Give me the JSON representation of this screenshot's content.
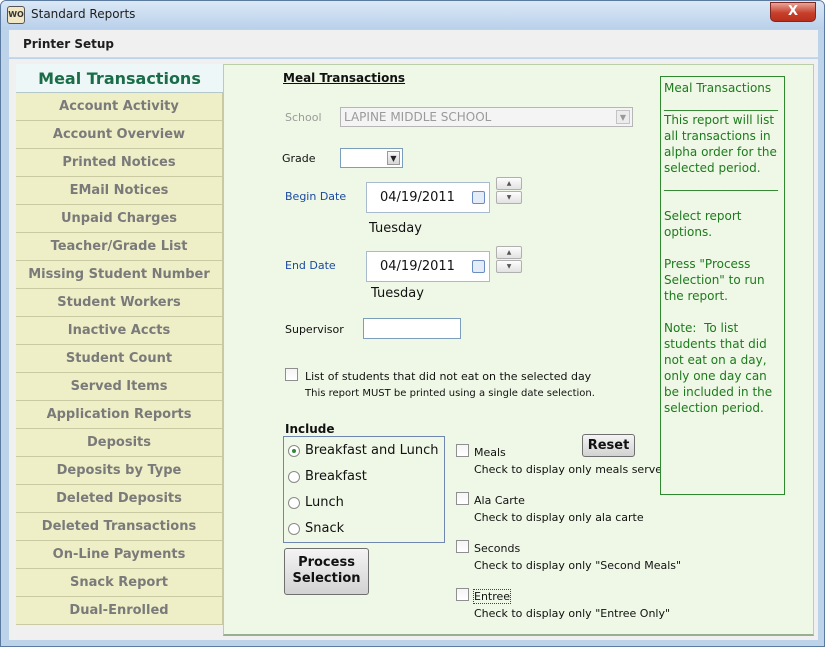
{
  "window": {
    "title": "Standard Reports",
    "icon_text": "WO",
    "close_label": "X"
  },
  "menu": {
    "printer_setup": "Printer Setup"
  },
  "sidebar": {
    "active": "Meal Transactions",
    "items": [
      "Account Activity",
      "Account Overview",
      "Printed Notices",
      "EMail Notices",
      "Unpaid Charges",
      "Teacher/Grade List",
      "Missing Student Number",
      "Student Workers",
      "Inactive Accts",
      "Student Count",
      "Served Items",
      "Application Reports",
      "Deposits",
      "Deposits by Type",
      "Deleted Deposits",
      "Deleted Transactions",
      "On-Line Payments",
      "Snack Report",
      "Dual-Enrolled"
    ]
  },
  "form": {
    "heading": "Meal Transactions",
    "school_label": "School",
    "school_value": "LAPINE MIDDLE SCHOOL",
    "grade_label": "Grade",
    "grade_value": "",
    "begin_label": "Begin Date",
    "begin_value": "04/19/2011",
    "begin_day": "Tuesday",
    "end_label": "End Date",
    "end_value": "04/19/2011",
    "end_day": "Tuesday",
    "supervisor_label": "Supervisor",
    "supervisor_value": "",
    "not_eat_label": "List of students that did not eat on the selected day",
    "not_eat_note": "This report MUST be printed using a single date selection.",
    "include_label": "Include",
    "include_options": [
      "Breakfast and Lunch",
      "Breakfast",
      "Lunch",
      "Snack"
    ],
    "include_selected": "Breakfast and Lunch",
    "process_line1": "Process",
    "process_line2": "Selection",
    "reset_label": "Reset",
    "filters": [
      {
        "label": "Meals",
        "note": "Check to display only meals served"
      },
      {
        "label": "Ala Carte",
        "note": "Check to display only ala carte"
      },
      {
        "label": "Seconds",
        "note": "Check to display only \"Second Meals\""
      },
      {
        "label": "Entree",
        "note": "Check to display only \"Entree Only\""
      }
    ]
  },
  "info": {
    "text": "Meal Transactions\n___________________\nThis report will list all transactions in alpha order for the selected period.\n___________________\n\nSelect report options.\n\nPress \"Process Selection\" to run the report.\n\nNote:  To list students that did not eat on a day, only one day can be included in the selection period."
  },
  "colors": {
    "active_tab_text": "#1b6d4a",
    "info_text": "#1d7a1d",
    "date_label": "#1a4aa0"
  },
  "icons": {
    "app": "app-icon",
    "close": "close-icon",
    "calendar": "calendar-icon",
    "spin_up": "chevron-up-icon",
    "spin_down": "chevron-down-icon"
  }
}
